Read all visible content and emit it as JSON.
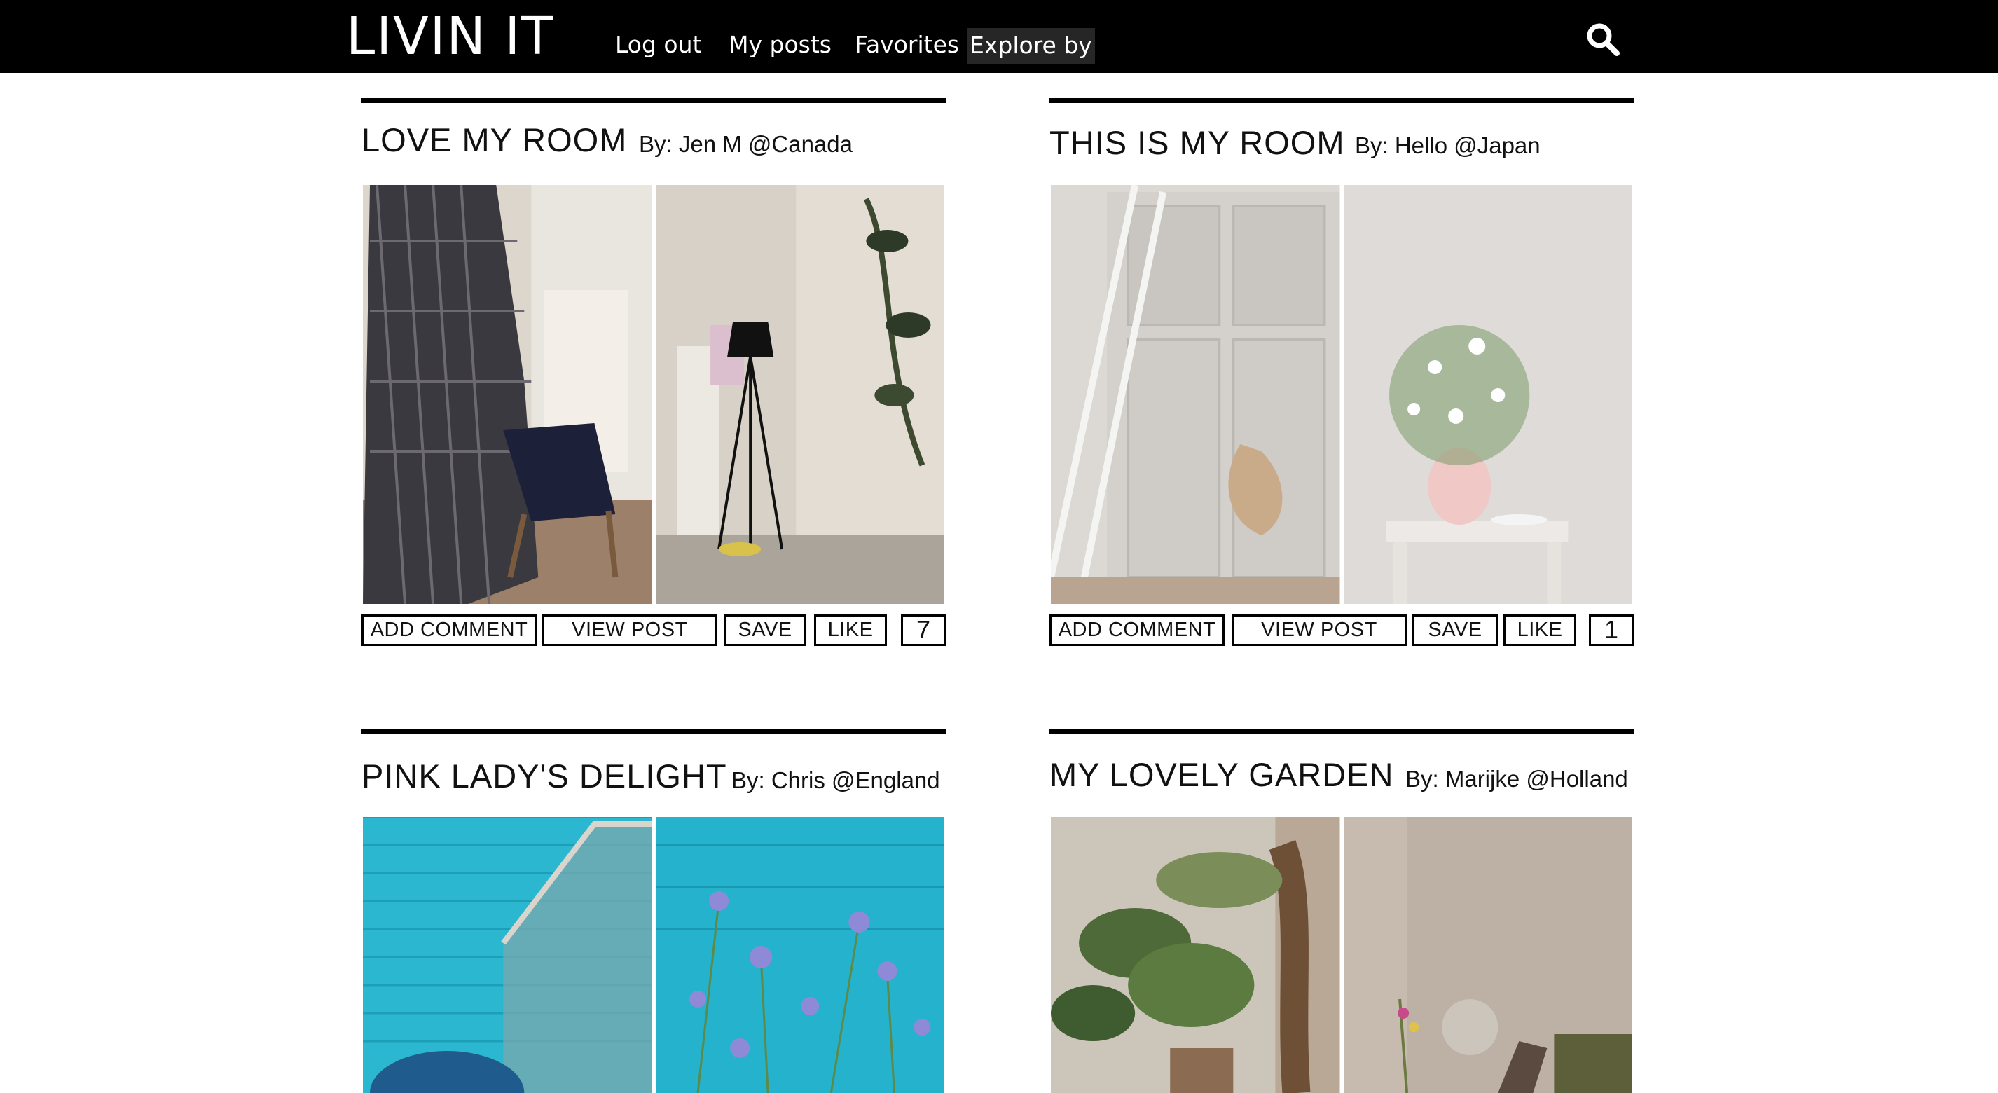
{
  "header": {
    "logo": "LIVIN IT",
    "nav": [
      "Log out",
      "My posts",
      "Favorites",
      "Explore by"
    ],
    "search_icon": "search-icon"
  },
  "posts": [
    {
      "title": "LOVE MY ROOM",
      "byline": "By: Jen M @Canada",
      "likes": "7",
      "actions": [
        "ADD COMMENT",
        "VIEW POST",
        "SAVE",
        "LIKE"
      ]
    },
    {
      "title": "THIS IS MY ROOM",
      "byline": "By: Hello @Japan",
      "likes": "1",
      "actions": [
        "ADD COMMENT",
        "VIEW POST",
        "SAVE",
        "LIKE"
      ]
    },
    {
      "title": "PINK LADY'S DELIGHT",
      "byline": "By: Chris @England"
    },
    {
      "title": "MY LOVELY GARDEN",
      "byline": "By: Marijke @Holland"
    }
  ]
}
